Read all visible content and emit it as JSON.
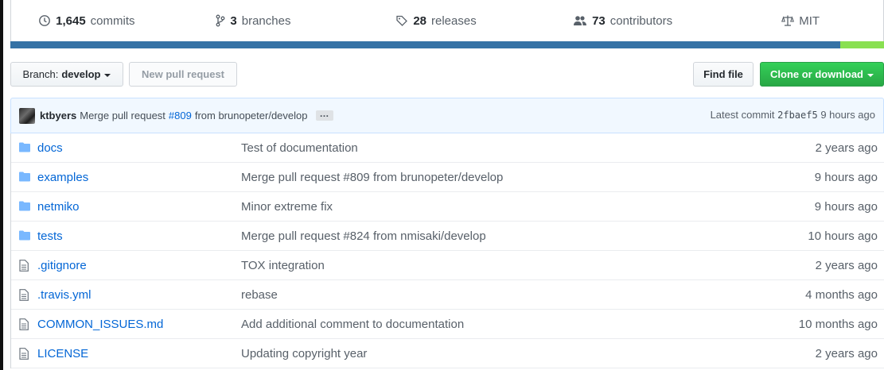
{
  "summary": {
    "commits": {
      "count": "1,645",
      "label": "commits"
    },
    "branches": {
      "count": "3",
      "label": "branches"
    },
    "releases": {
      "count": "28",
      "label": "releases"
    },
    "contributors": {
      "count": "73",
      "label": "contributors"
    },
    "license": {
      "label": "MIT"
    }
  },
  "language_bar": {
    "segments": [
      {
        "color": "#3572A5",
        "fraction": 0.95
      },
      {
        "color": "#89e051",
        "fraction": 0.05
      }
    ]
  },
  "toolbar": {
    "branch_prefix": "Branch:",
    "branch_name": "develop",
    "new_pr_label": "New pull request",
    "find_file_label": "Find file",
    "clone_label": "Clone or download"
  },
  "latest_commit": {
    "author": "ktbyers",
    "message_pre": "Merge pull request",
    "pr_link": "#809",
    "message_post": "from brunopeter/develop",
    "ellipsis": "…",
    "latest_label": "Latest commit",
    "sha": "2fbaef5",
    "age": "9 hours ago"
  },
  "files": [
    {
      "type": "dir",
      "icon": "folder-icon",
      "name": "docs",
      "message": "Test of documentation",
      "age": "2 years ago"
    },
    {
      "type": "dir",
      "icon": "folder-icon",
      "name": "examples",
      "message": "Merge pull request #809 from brunopeter/develop",
      "age": "9 hours ago"
    },
    {
      "type": "dir",
      "icon": "folder-icon",
      "name": "netmiko",
      "message": "Minor extreme fix",
      "age": "9 hours ago"
    },
    {
      "type": "dir",
      "icon": "folder-icon",
      "name": "tests",
      "message": "Merge pull request #824 from nmisaki/develop",
      "age": "10 hours ago"
    },
    {
      "type": "file",
      "icon": "file-icon",
      "name": ".gitignore",
      "message": "TOX integration",
      "age": "2 years ago"
    },
    {
      "type": "file",
      "icon": "file-icon",
      "name": ".travis.yml",
      "message": "rebase",
      "age": "4 months ago"
    },
    {
      "type": "file",
      "icon": "file-icon",
      "name": "COMMON_ISSUES.md",
      "message": "Add additional comment to documentation",
      "age": "10 months ago"
    },
    {
      "type": "file",
      "icon": "file-icon",
      "name": "LICENSE",
      "message": "Updating copyright year",
      "age": "2 years ago"
    }
  ]
}
